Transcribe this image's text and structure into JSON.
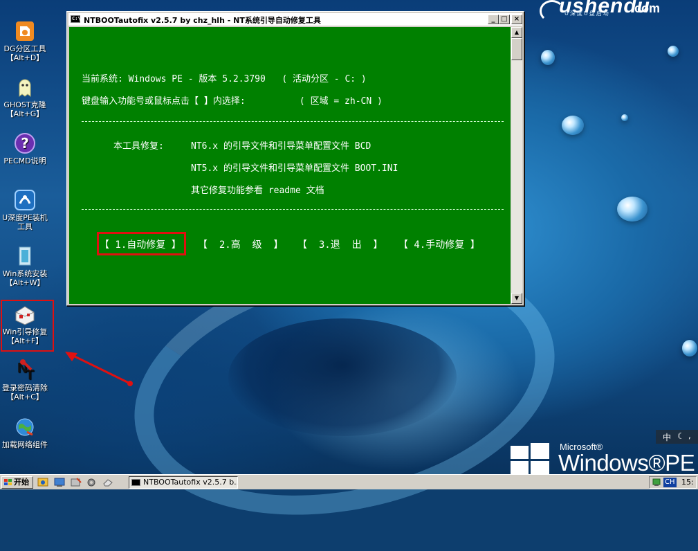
{
  "brand": {
    "logo_text": "ushendu",
    "domain": ".com",
    "slogan": "U深度U盘启动"
  },
  "pe_logo": {
    "microsoft": "Microsoft®",
    "windows_pe": "Windows®PE"
  },
  "desktop_icons": [
    {
      "label": "DG分区工具",
      "shortcut": "【Alt+D】",
      "icon": "dg-partition-icon"
    },
    {
      "label": "GHOST克隆",
      "shortcut": "【Alt+G】",
      "icon": "ghost-clone-icon"
    },
    {
      "label": "PECMD说明",
      "shortcut": "",
      "icon": "help-icon"
    },
    {
      "label": "U深度PE装机",
      "shortcut": "工具",
      "icon": "pe-installer-icon"
    },
    {
      "label": "Win系统安装",
      "shortcut": "【Alt+W】",
      "icon": "win-install-icon"
    },
    {
      "label": "Win引导修复",
      "shortcut": "【Alt+F】",
      "icon": "boot-repair-icon"
    },
    {
      "label": "登录密码清除",
      "shortcut": "【Alt+C】",
      "icon": "password-clear-icon"
    },
    {
      "label": "加载网络组件",
      "shortcut": "",
      "icon": "network-icon"
    }
  ],
  "window": {
    "title": "NTBOOTautofix v2.5.7 by chz_hlh - NT系统引导自动修复工具",
    "console": {
      "line1": "当前系统: Windows PE - 版本 5.2.3790   ( 活动分区 - C: )",
      "line2": "键盘输入功能号或鼠标点击【 】内选择:          ( 区域 = zh-CN )",
      "repair_label": "本工具修复:",
      "repair_nt6": "NT6.x 的引导文件和引导菜单配置文件 BCD",
      "repair_nt5": "NT5.x 的引导文件和引导菜单配置文件 BOOT.INI",
      "repair_other": "其它修复功能参看 readme 文档",
      "menu": [
        {
          "label": "【 1.自动修复 】"
        },
        {
          "label": "【  2.高  级  】"
        },
        {
          "label": "【  3.退  出  】"
        },
        {
          "label": "【 4.手动修复 】"
        }
      ]
    }
  },
  "langbar": {
    "text": "中"
  },
  "taskbar": {
    "start_label": "开始",
    "task_item": "NTBOOTautofix v2.5.7 b...",
    "lang": "CH",
    "clock": "15:"
  },
  "colors": {
    "console_bg": "#008000",
    "highlight_red": "#e01010"
  }
}
